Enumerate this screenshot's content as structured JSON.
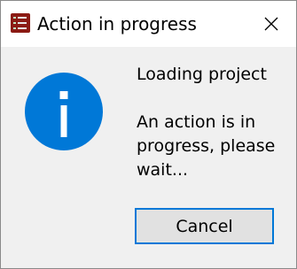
{
  "window": {
    "title": "Action in progress",
    "app_icon": "app-icon",
    "close_icon": "close-icon"
  },
  "dialog": {
    "icon": "info-icon",
    "icon_color": "#0078d7",
    "heading": "Loading project",
    "message": "An action is in progress, please wait..."
  },
  "buttons": {
    "cancel_label": "Cancel",
    "accent": "#0078d7"
  }
}
